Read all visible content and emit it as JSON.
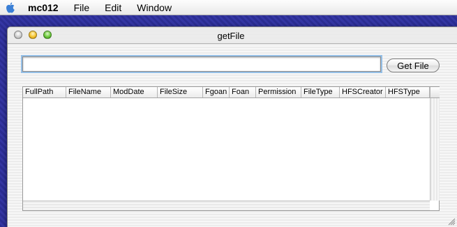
{
  "menubar": {
    "apple_icon": "apple-icon",
    "app_name": "mc012",
    "items": [
      "File",
      "Edit",
      "Window"
    ]
  },
  "window": {
    "title": "getFile",
    "path_field": {
      "value": "",
      "placeholder": ""
    },
    "get_button_label": "Get File",
    "table": {
      "columns": [
        "FullPath",
        "FileName",
        "ModDate",
        "FileSize",
        "Fgoan",
        "Foan",
        "Permission",
        "FileType",
        "HFSCreator",
        "HFSType"
      ],
      "rows": []
    }
  },
  "colors": {
    "desktop": "#2b2d93",
    "focus_ring": "#95bfe6",
    "close_button": "#c9c9c9",
    "minimize_button": "#f4c32f",
    "zoom_button": "#6cc93b"
  }
}
